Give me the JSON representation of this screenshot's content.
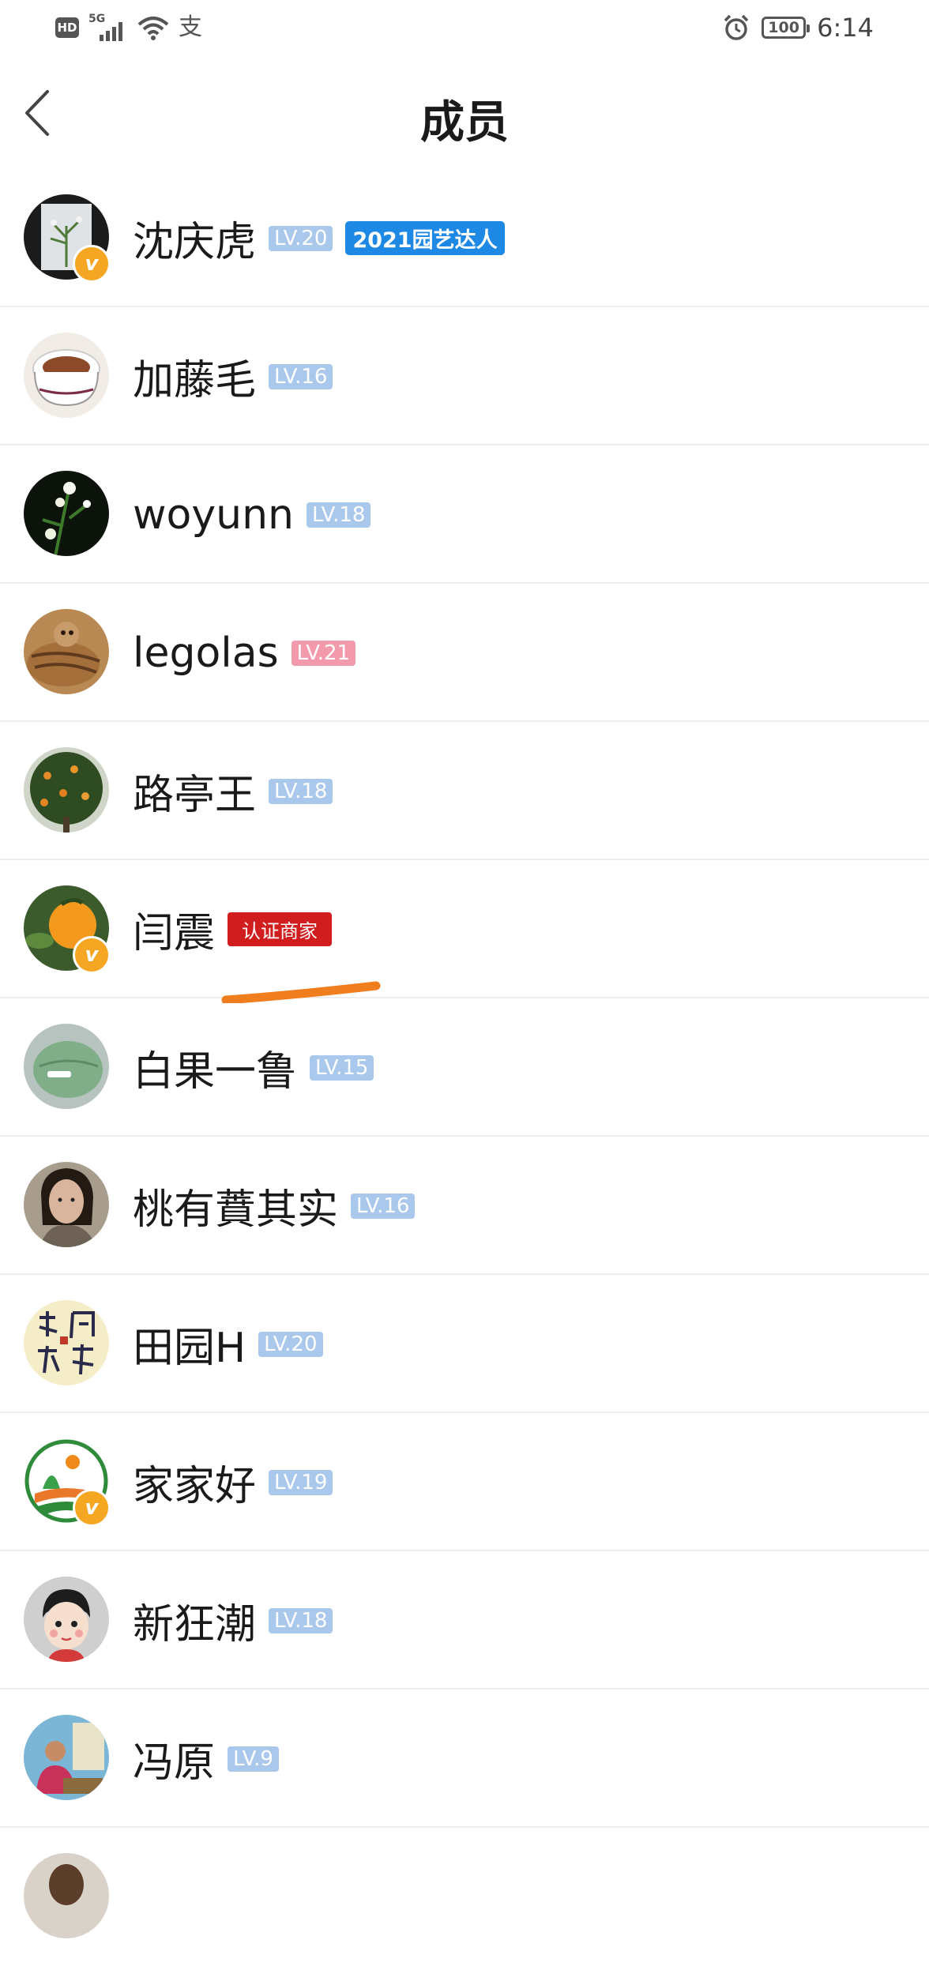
{
  "status_bar": {
    "hd": "HD",
    "network": "5G",
    "alipay_glyph": "支",
    "battery": "100",
    "time": "6:14"
  },
  "header": {
    "title": "成员"
  },
  "members": [
    {
      "name": "沈庆虎",
      "level": "LV.20",
      "level_color": "blue",
      "verified": true,
      "badge": "2021园艺达人"
    },
    {
      "name": "加藤毛",
      "level": "LV.16",
      "level_color": "blue",
      "verified": false
    },
    {
      "name": "woyunn",
      "level": "LV.18",
      "level_color": "blue",
      "verified": false
    },
    {
      "name": "legolas",
      "level": "LV.21",
      "level_color": "pink",
      "verified": false
    },
    {
      "name": "路亭王",
      "level": "LV.18",
      "level_color": "blue",
      "verified": false
    },
    {
      "name": "闫震",
      "level": "",
      "verified": true,
      "merchant_tag": "认证商家"
    },
    {
      "name": "白果一鲁",
      "level": "LV.15",
      "level_color": "blue",
      "verified": false
    },
    {
      "name": "桃有蕡其实",
      "level": "LV.16",
      "level_color": "blue",
      "verified": false
    },
    {
      "name": "田园H",
      "level": "LV.20",
      "level_color": "blue",
      "verified": false
    },
    {
      "name": "家家好",
      "level": "LV.19",
      "level_color": "blue",
      "verified": true
    },
    {
      "name": "新狂潮",
      "level": "LV.18",
      "level_color": "blue",
      "verified": false
    },
    {
      "name": "冯原",
      "level": "LV.9",
      "level_color": "blue",
      "verified": false
    }
  ],
  "icons": {
    "back": "chevron-left-icon",
    "alarm": "alarm-icon",
    "wifi": "wifi-icon",
    "verified": "verified-v-icon"
  },
  "colors": {
    "level_blue": "#a9c8ec",
    "level_pink": "#f29aab",
    "verified_orange": "#f5a623",
    "merchant_red": "#d11d1d",
    "badge_blue": "#1e88e5",
    "annotation_orange": "#f07d1e"
  }
}
